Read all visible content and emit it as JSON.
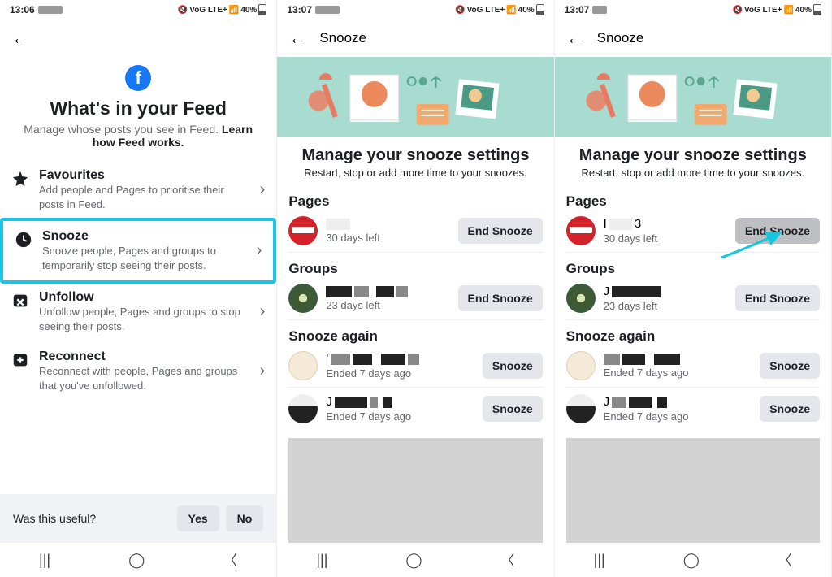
{
  "status": {
    "s1_time": "13:06",
    "s2_time": "13:07",
    "s3_time": "13:07",
    "network": "VoG LTE+",
    "signal": "LTE1",
    "battery": "40%"
  },
  "screen1": {
    "title": "What's in your Feed",
    "subtitle_a": "Manage whose posts you see in Feed. ",
    "subtitle_b": "Learn how Feed works.",
    "items": [
      {
        "label": "Favourites",
        "desc": "Add people and Pages to prioritise their posts in Feed."
      },
      {
        "label": "Snooze",
        "desc": "Snooze people, Pages and groups to temporarily stop seeing their posts."
      },
      {
        "label": "Unfollow",
        "desc": "Unfollow people, Pages and groups to stop seeing their posts."
      },
      {
        "label": "Reconnect",
        "desc": "Reconnect with people, Pages and groups that you've unfollowed."
      }
    ],
    "helpful": "Was this useful?",
    "yes": "Yes",
    "no": "No"
  },
  "snooze_header_title": "Snooze",
  "snooze": {
    "title": "Manage your snooze settings",
    "subtitle": "Restart, stop or add more time to your snoozes.",
    "sections": {
      "pages": "Pages",
      "groups": "Groups",
      "again": "Snooze again"
    },
    "end_btn": "End Snooze",
    "snooze_btn": "Snooze",
    "page_meta": "30 days left",
    "group_meta": "23 days left",
    "again_meta": "Ended 7 days ago"
  },
  "s3_page_name_prefix": "I",
  "s3_page_name_suffix": "3",
  "s3_again_prefix": "J"
}
